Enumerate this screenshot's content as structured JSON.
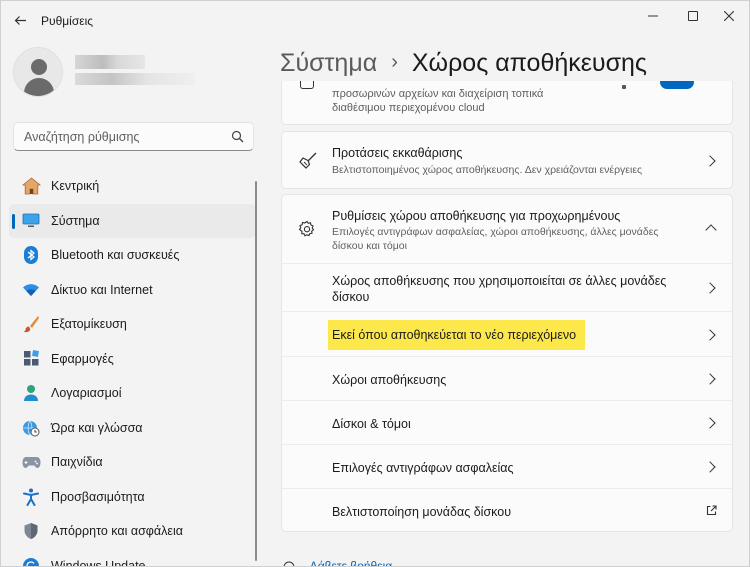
{
  "window": {
    "title": "Ρυθμίσεις"
  },
  "profile": {},
  "search": {
    "placeholder": "Αναζήτηση ρύθμισης"
  },
  "nav": {
    "items": [
      {
        "label": "Κεντρική",
        "icon": "home-icon"
      },
      {
        "label": "Σύστημα",
        "icon": "monitor-icon",
        "active": true
      },
      {
        "label": "Bluetooth και συσκευές",
        "icon": "bluetooth-icon"
      },
      {
        "label": "Δίκτυο και Internet",
        "icon": "wifi-icon"
      },
      {
        "label": "Εξατομίκευση",
        "icon": "brush-icon"
      },
      {
        "label": "Εφαρμογές",
        "icon": "apps-icon"
      },
      {
        "label": "Λογαριασμοί",
        "icon": "person-icon"
      },
      {
        "label": "Ώρα και γλώσσα",
        "icon": "globe-clock-icon"
      },
      {
        "label": "Παιχνίδια",
        "icon": "gamepad-icon"
      },
      {
        "label": "Προσβασιμότητα",
        "icon": "accessibility-icon"
      },
      {
        "label": "Απόρρητο και ασφάλεια",
        "icon": "shield-icon"
      },
      {
        "label": "Windows Update",
        "icon": "update-icon"
      }
    ]
  },
  "breadcrumb": {
    "parent": "Σύστημα",
    "separator": "›",
    "current": "Χώρος αποθήκευσης"
  },
  "partial_card": {
    "desc_line1": "προσωρινών αρχείων και διαχείριση τοπικά",
    "desc_line2": "διαθέσιμου περιεχομένου cloud"
  },
  "cleanup": {
    "title": "Προτάσεις εκκαθάρισης",
    "desc": "Βελτιστοποιημένος χώρος αποθήκευσης. Δεν χρειάζονται ενέργειες"
  },
  "advanced": {
    "title": "Ρυθμίσεις χώρου αποθήκευσης για προχωρημένους",
    "desc": "Επιλογές αντιγράφων ασφαλείας, χώροι αποθήκευσης, άλλες μονάδες δίσκου και τόμοι",
    "subitems": [
      {
        "label": "Χώρος αποθήκευσης που χρησιμοποιείται σε άλλες μονάδες δίσκου"
      },
      {
        "label": "Εκεί όπου αποθηκεύεται το νέο περιεχόμενο",
        "highlighted": true
      },
      {
        "label": "Χώροι αποθήκευσης"
      },
      {
        "label": "Δίσκοι & τόμοι"
      },
      {
        "label": "Επιλογές αντιγράφων ασφαλείας"
      },
      {
        "label": "Βελτιστοποίηση μονάδας δίσκου",
        "external": true
      }
    ]
  },
  "related": {
    "label": "Λάβετε βοήθεια"
  },
  "colors": {
    "accent": "#0067c0",
    "highlight": "#fde84b",
    "background": "#f3f3f3",
    "card": "#fbfbfb"
  }
}
